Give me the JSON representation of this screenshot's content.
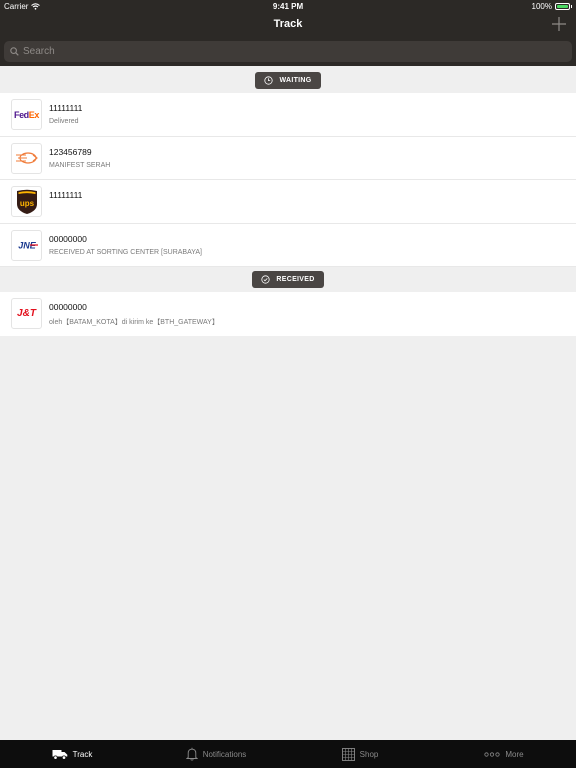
{
  "status_bar": {
    "carrier": "Carrier",
    "time": "9:41 PM",
    "battery": "100%"
  },
  "nav": {
    "title": "Track"
  },
  "search": {
    "placeholder": "Search"
  },
  "sections": [
    {
      "label": "WAITING",
      "icon": "clock-icon",
      "items": [
        {
          "courier": "FedEx",
          "logo_icon": "fedex-logo",
          "tracking_number": "11111111",
          "status": "Delivered"
        },
        {
          "courier": "Pos Indonesia",
          "logo_icon": "pos-indonesia-logo",
          "tracking_number": "123456789",
          "status": "MANIFEST SERAH"
        },
        {
          "courier": "UPS",
          "logo_icon": "ups-logo",
          "tracking_number": "11111111",
          "status": ""
        },
        {
          "courier": "JNE",
          "logo_icon": "jne-logo",
          "tracking_number": "00000000",
          "status": "RECEIVED AT SORTING CENTER [SURABAYA]"
        }
      ]
    },
    {
      "label": "RECEIVED",
      "icon": "check-circle-icon",
      "items": [
        {
          "courier": "J&T",
          "logo_icon": "jnt-logo",
          "tracking_number": "00000000",
          "status": "oleh【BATAM_KOTA】di kirim ke【BTH_GATEWAY】"
        }
      ]
    }
  ],
  "logos": {
    "fedex_a": "Fed",
    "fedex_b": "Ex",
    "ups": "ups",
    "jne": "JNE",
    "jnt": "J&T"
  },
  "tabs": [
    {
      "label": "Track",
      "icon": "truck-icon",
      "active": true
    },
    {
      "label": "Notifications",
      "icon": "bell-icon",
      "active": false
    },
    {
      "label": "Shop",
      "icon": "shop-grid-icon",
      "active": false
    },
    {
      "label": "More",
      "icon": "more-dots-icon",
      "active": false
    }
  ],
  "colors": {
    "nav_bg": "#2c2926",
    "tab_bar_bg": "#0d0d0d",
    "battery": "#4cd964",
    "fedex_purple": "#4d148c",
    "fedex_orange": "#ff6600",
    "ups_brown": "#351c15",
    "ups_gold": "#ffb500",
    "jnt_red": "#e3101d",
    "jne_blue": "#1b3a8f"
  }
}
